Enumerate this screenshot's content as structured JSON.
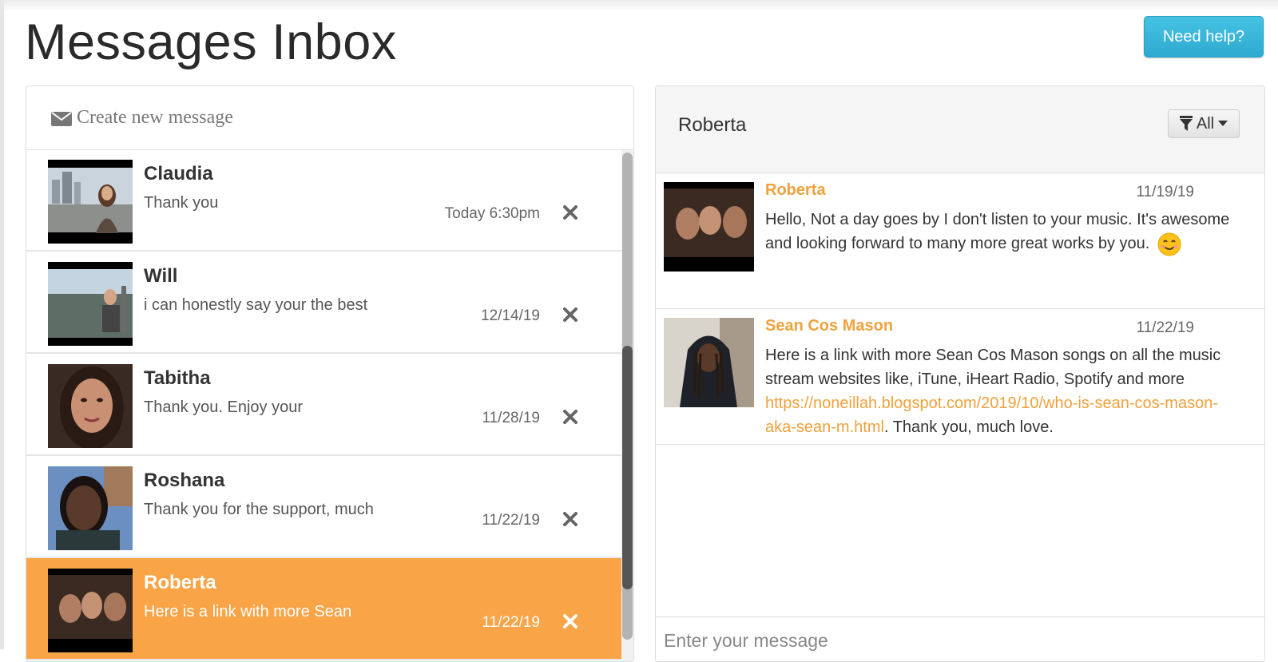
{
  "page": {
    "title": "Messages Inbox",
    "help_label": "Need help?"
  },
  "sidebar": {
    "compose_label": "Create new message",
    "conversations": [
      {
        "name": "",
        "snippet": "",
        "date": ""
      },
      {
        "name": "Claudia",
        "snippet": "Thank you",
        "date": "Today 6:30pm"
      },
      {
        "name": "Will",
        "snippet": "i can honestly say your the best",
        "date": "12/14/19"
      },
      {
        "name": "Tabitha",
        "snippet": "Thank you. Enjoy your",
        "date": "11/28/19"
      },
      {
        "name": "Roshana",
        "snippet": "Thank you for the support, much",
        "date": "11/22/19"
      },
      {
        "name": "Roberta",
        "snippet": "Here is a link with more Sean",
        "date": "11/22/19",
        "active": true
      }
    ]
  },
  "thread": {
    "title": "Roberta",
    "filter_label": "All",
    "messages": [
      {
        "author": "Roberta",
        "date": "11/19/19",
        "text": "Hello, Not a day goes by I don't listen to your music. It's awesome and looking forward to many more great works by you.",
        "emoji": "smiling-face-icon"
      },
      {
        "author": "Sean Cos Mason",
        "date": "11/22/19",
        "text_before": "Here is a link with more Sean Cos Mason songs on all the music stream websites like, iTune, iHeart Radio, Spotify and more ",
        "link": "https://noneillah.blogspot.com/2019/10/who-is-sean-cos-mason-aka-sean-m.html",
        "text_after": ". Thank you, much love."
      }
    ],
    "compose_placeholder": "Enter your message"
  },
  "colors": {
    "accent": "#f8a447",
    "help_button": "#39b4da",
    "author": "#f0a13c"
  }
}
